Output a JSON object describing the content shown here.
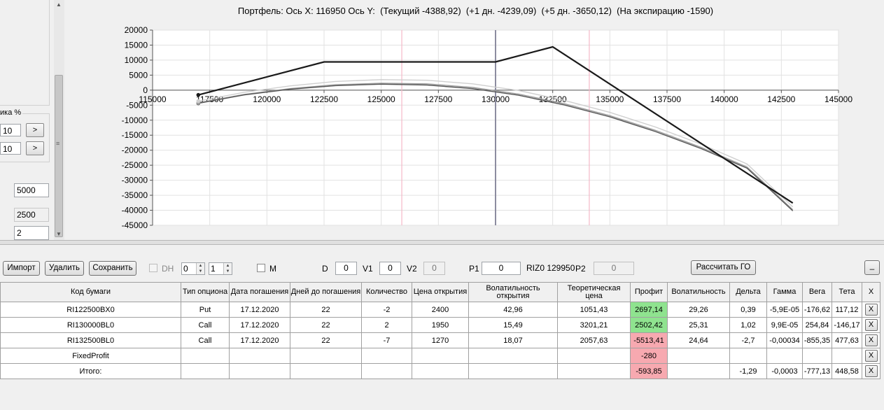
{
  "left_panel": {
    "group_label": "ика %",
    "input1": "10",
    "input2": "10",
    "arrow_label": ">",
    "grip_label": "≡",
    "value1": "5000",
    "value2": "2500",
    "value3": "2"
  },
  "chart_data": {
    "type": "line",
    "title": "Портфель: Ось X: 116950 Ось Y:  (Текущий -4388,92)  (+1 дн. -4239,09)  (+5 дн. -3650,12)  (На экспирацию -1590)",
    "xlim": [
      115000,
      145000
    ],
    "ylim": [
      -45000,
      20000
    ],
    "x_ticks": [
      115000,
      117500,
      120000,
      122500,
      125000,
      127500,
      130000,
      132500,
      135000,
      137500,
      140000,
      142500,
      145000
    ],
    "y_ticks": [
      20000,
      15000,
      10000,
      5000,
      0,
      -5000,
      -10000,
      -15000,
      -20000,
      -25000,
      -30000,
      -35000,
      -40000,
      -45000
    ],
    "grid": true,
    "vertical_lines": [
      {
        "x": 125900,
        "color": "#f4b8c8"
      },
      {
        "x": 130000,
        "color": "#8c8ca0"
      },
      {
        "x": 134100,
        "color": "#f4b8c8"
      }
    ],
    "series": [
      {
        "color": "#1a1a1a",
        "points": [
          [
            117000,
            -1590
          ],
          [
            122500,
            9410
          ],
          [
            130000,
            9410
          ],
          [
            132500,
            14410
          ],
          [
            143000,
            -37590
          ]
        ]
      },
      {
        "color": "#555555",
        "points": [
          [
            117000,
            -4390
          ],
          [
            119000,
            -1600
          ],
          [
            121000,
            300
          ],
          [
            123000,
            1500
          ],
          [
            125000,
            2000
          ],
          [
            127000,
            1700
          ],
          [
            129000,
            500
          ],
          [
            131000,
            -1700
          ],
          [
            133000,
            -4900
          ],
          [
            135000,
            -8900
          ],
          [
            137000,
            -13800
          ],
          [
            139000,
            -19500
          ],
          [
            141000,
            -26000
          ],
          [
            143000,
            -40200
          ]
        ]
      },
      {
        "color": "#9a9a9a",
        "points": [
          [
            117000,
            -4239
          ],
          [
            119000,
            -1400
          ],
          [
            121000,
            500
          ],
          [
            123000,
            1800
          ],
          [
            125000,
            2300
          ],
          [
            127000,
            2100
          ],
          [
            129000,
            900
          ],
          [
            131000,
            -1300
          ],
          [
            133000,
            -4500
          ],
          [
            135000,
            -8500
          ],
          [
            137000,
            -13400
          ],
          [
            139000,
            -19100
          ],
          [
            141000,
            -25600
          ],
          [
            143000,
            -39800
          ]
        ]
      },
      {
        "color": "#cfcfcf",
        "points": [
          [
            117000,
            -3650
          ],
          [
            119000,
            -700
          ],
          [
            121000,
            1400
          ],
          [
            123000,
            2900
          ],
          [
            125000,
            3500
          ],
          [
            127000,
            3300
          ],
          [
            129000,
            2100
          ],
          [
            131000,
            -100
          ],
          [
            133000,
            -3400
          ],
          [
            135000,
            -7400
          ],
          [
            137000,
            -12300
          ],
          [
            139000,
            -18000
          ],
          [
            141000,
            -24600
          ],
          [
            143000,
            -38900
          ]
        ]
      }
    ]
  },
  "toolbar": {
    "import_label": "Импорт",
    "delete_label": "Удалить",
    "save_label": "Сохранить",
    "dh_label": "DH",
    "spin1_value": "0",
    "spin2_value": "1",
    "m_label": "M",
    "d_label": "D",
    "d_value": "0",
    "v1_label": "V1",
    "v1_value": "0",
    "v2_label": "V2",
    "v2_value": "0",
    "p1_label": "P1",
    "p1_value": "0",
    "riz_label": "RIZ0 129950",
    "p2_label": "P2",
    "p2_value": "0",
    "calc_label": "Рассчитать ГО",
    "minimize_label": "_"
  },
  "table": {
    "headers": [
      "Код бумаги",
      "Тип опциона",
      "Дата погашения",
      "Дней до погашения",
      "Количество",
      "Цена открытия",
      "Волатильность открытия",
      "Теоретическая цена",
      "Профит",
      "Волатильность",
      "Дельта",
      "Гамма",
      "Вега",
      "Тета",
      "X"
    ],
    "rows": [
      {
        "code": "RI122500BX0",
        "type": "Put",
        "date": "17.12.2020",
        "days": "22",
        "qty": "-2",
        "price": "2400",
        "vol_open": "42,96",
        "theo": "1051,43",
        "profit": "2697,14",
        "profit_status": "green",
        "vol": "29,26",
        "delta": "0,39",
        "gamma": "-5,9E-05",
        "vega": "-176,62",
        "theta": "117,12",
        "x": "X"
      },
      {
        "code": "RI130000BL0",
        "type": "Call",
        "date": "17.12.2020",
        "days": "22",
        "qty": "2",
        "price": "1950",
        "vol_open": "15,49",
        "theo": "3201,21",
        "profit": "2502,42",
        "profit_status": "green",
        "vol": "25,31",
        "delta": "1,02",
        "gamma": "9,9E-05",
        "vega": "254,84",
        "theta": "-146,17",
        "x": "X"
      },
      {
        "code": "RI132500BL0",
        "type": "Call",
        "date": "17.12.2020",
        "days": "22",
        "qty": "-7",
        "price": "1270",
        "vol_open": "18,07",
        "theo": "2057,63",
        "profit": "-5513,41",
        "profit_status": "red",
        "vol": "24,64",
        "delta": "-2,7",
        "gamma": "-0,00034",
        "vega": "-855,35",
        "theta": "477,63",
        "x": "X"
      },
      {
        "code": "FixedProfit",
        "type": "",
        "date": "",
        "days": "",
        "qty": "",
        "price": "",
        "vol_open": "",
        "theo": "",
        "profit": "-280",
        "profit_status": "red",
        "vol": "",
        "delta": "",
        "gamma": "",
        "vega": "",
        "theta": "",
        "x": "X"
      },
      {
        "code": "Итого:",
        "type": "",
        "date": "",
        "days": "",
        "qty": "",
        "price": "",
        "vol_open": "",
        "theo": "",
        "profit": "-593,85",
        "profit_status": "red",
        "vol": "",
        "delta": "-1,29",
        "gamma": "-0,0003",
        "vega": "-777,13",
        "theta": "448,58",
        "x": "X"
      }
    ]
  }
}
